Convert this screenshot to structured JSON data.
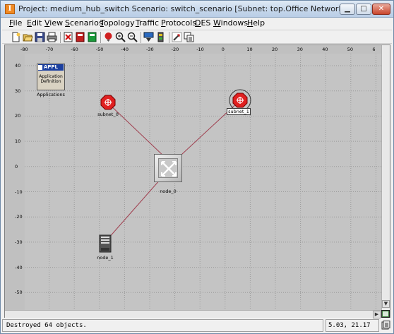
{
  "window": {
    "title": "Project: medium_hub_switch Scenario: switch_scenario  [Subnet: top.Office Network]",
    "minimize_label": "▁",
    "maximize_label": "□",
    "close_label": "✕"
  },
  "menu": [
    {
      "key": "F",
      "rest": "ile"
    },
    {
      "key": "E",
      "rest": "dit"
    },
    {
      "key": "V",
      "rest": "iew"
    },
    {
      "key": "S",
      "rest": "cenarios"
    },
    {
      "key": "T",
      "rest": "opology"
    },
    {
      "key": "T",
      "rest": "raffic"
    },
    {
      "key": "P",
      "rest": "rotocols"
    },
    {
      "key": "D",
      "rest": "ES"
    },
    {
      "key": "W",
      "rest": "indows"
    },
    {
      "key": "H",
      "rest": "elp"
    }
  ],
  "toolbar_icons": [
    "new-icon",
    "open-icon",
    "save-icon",
    "print-icon",
    "delete-icon",
    "check-links-icon",
    "object-palette-icon",
    "zoom-in-icon",
    "zoom-out-icon",
    "configure-des-icon",
    "results-icon",
    "fail-link-icon",
    "hierarchy-icon",
    "edit-attributes-icon"
  ],
  "ruler": {
    "x_ticks": [
      "-80",
      "-70",
      "-60",
      "-50",
      "-40",
      "-30",
      "-20",
      "-10",
      "0",
      "10",
      "20",
      "30",
      "40",
      "50",
      "6"
    ],
    "y_ticks": [
      "40",
      "30",
      "20",
      "10",
      "0",
      "-10",
      "-20",
      "-30",
      "-40",
      "-50"
    ]
  },
  "nodes": {
    "applications": {
      "badge": "APPL",
      "line1": "Application",
      "line2": "Definition",
      "label": "Applications"
    },
    "subnet_0": {
      "label": "subnet_0"
    },
    "subnet_1": {
      "label": "subnet_1"
    },
    "node_0": {
      "label": "node_0"
    },
    "node_1": {
      "label": "node_1"
    }
  },
  "colors": {
    "link": "#a04050",
    "subnet": "#e02020",
    "canvas": "#c4c4c4",
    "grid": "#9a9a9a"
  },
  "status": {
    "message": "Destroyed 64 objects.",
    "coordinates": "5.03, 21.17"
  }
}
